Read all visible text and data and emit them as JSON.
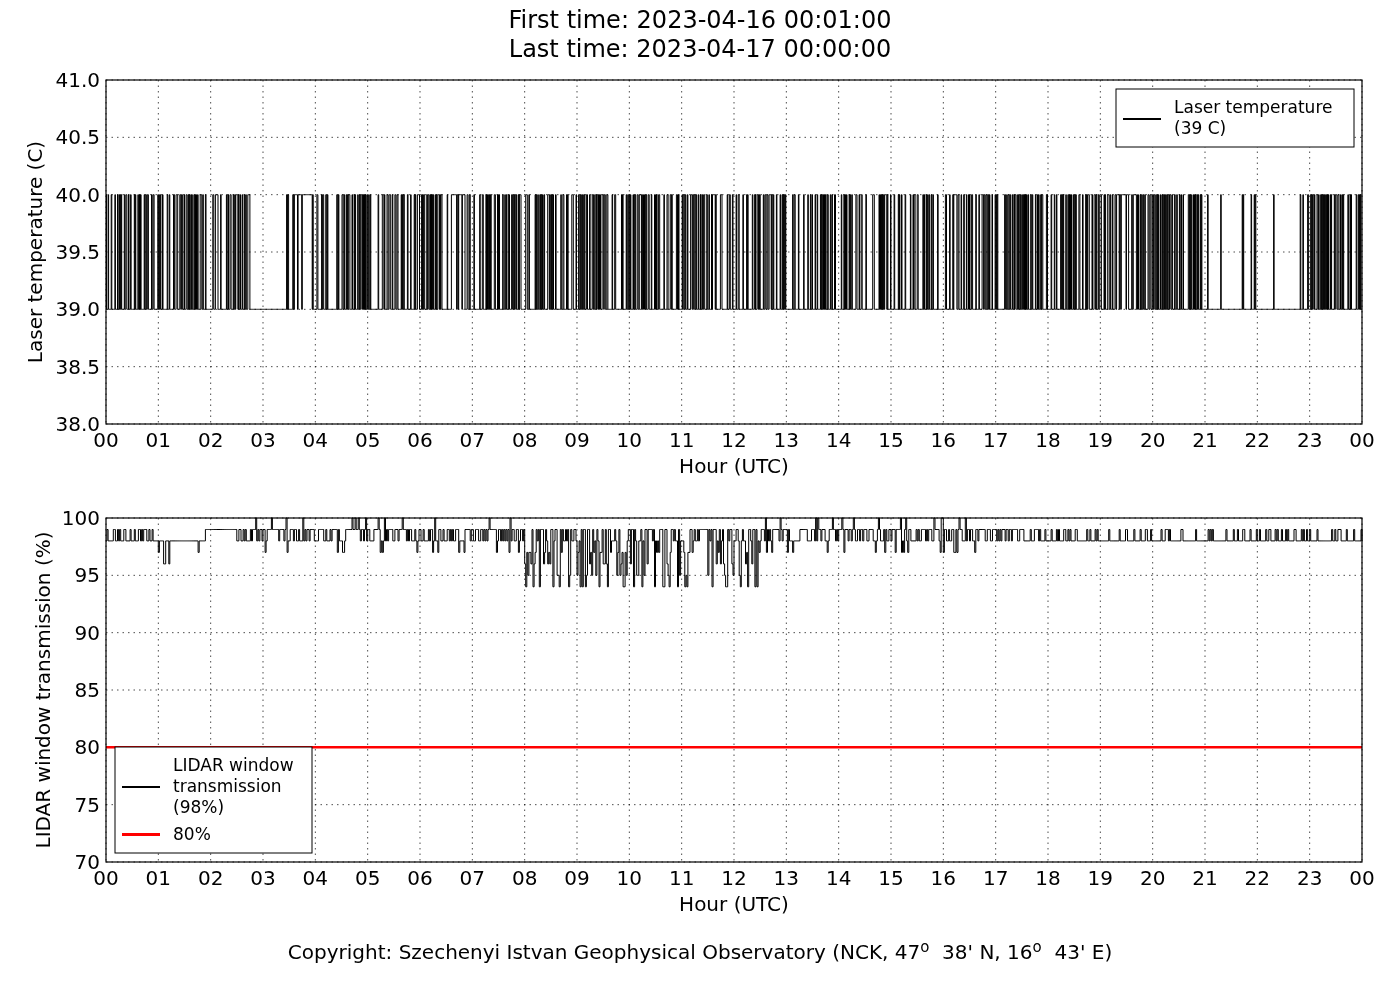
{
  "title_lines": [
    "First time: 2023-04-16 00:01:00",
    "Last time: 2023-04-17 00:00:00"
  ],
  "charts": [
    {
      "chart_data": {
        "type": "line",
        "xlabel": "Hour (UTC)",
        "ylabel": "Laser temperature (C)",
        "grid": true,
        "ylim": [
          38,
          41
        ],
        "categories": [
          "00",
          "01",
          "02",
          "03",
          "04",
          "05",
          "06",
          "07",
          "08",
          "09",
          "10",
          "11",
          "12",
          "13",
          "14",
          "15",
          "16",
          "17",
          "18",
          "19",
          "20",
          "21",
          "22",
          "23",
          "00"
        ],
        "yticks": [
          {
            "value": 38,
            "label": "38.0"
          },
          {
            "value": 38.5,
            "label": "38.5"
          },
          {
            "value": 39,
            "label": "39.0"
          },
          {
            "value": 39.5,
            "label": "39.5"
          },
          {
            "value": 40,
            "label": "40.0"
          },
          {
            "value": 40.5,
            "label": "40.5"
          },
          {
            "value": 41,
            "label": "41.0"
          }
        ]
      },
      "legend": [
        {
          "label": "Laser temperature\n(39 C)",
          "color": "#000000"
        }
      ]
    },
    {
      "chart_data": {
        "type": "line",
        "xlabel": "Hour (UTC)",
        "ylabel": "LIDAR window transmission (%)",
        "grid": true,
        "ylim": [
          70,
          100
        ],
        "categories": [
          "00",
          "01",
          "02",
          "03",
          "04",
          "05",
          "06",
          "07",
          "08",
          "09",
          "10",
          "11",
          "12",
          "13",
          "14",
          "15",
          "16",
          "17",
          "18",
          "19",
          "20",
          "21",
          "22",
          "23",
          "00"
        ],
        "yticks": [
          70,
          75,
          80,
          85,
          90,
          95,
          100
        ],
        "ref_lines": [
          {
            "axis": "y",
            "value": 80,
            "label": "80%",
            "color": "#ff0000"
          }
        ]
      },
      "legend": [
        {
          "label": "LIDAR window\ntransmission\n(98%)",
          "color": "#000000"
        }
      ]
    }
  ],
  "copyright": "Copyright: Szechenyi Istvan Geophysical Observatory (NCK, 47$^{o}$  38' N, 16$^{o}$  43' E)"
}
